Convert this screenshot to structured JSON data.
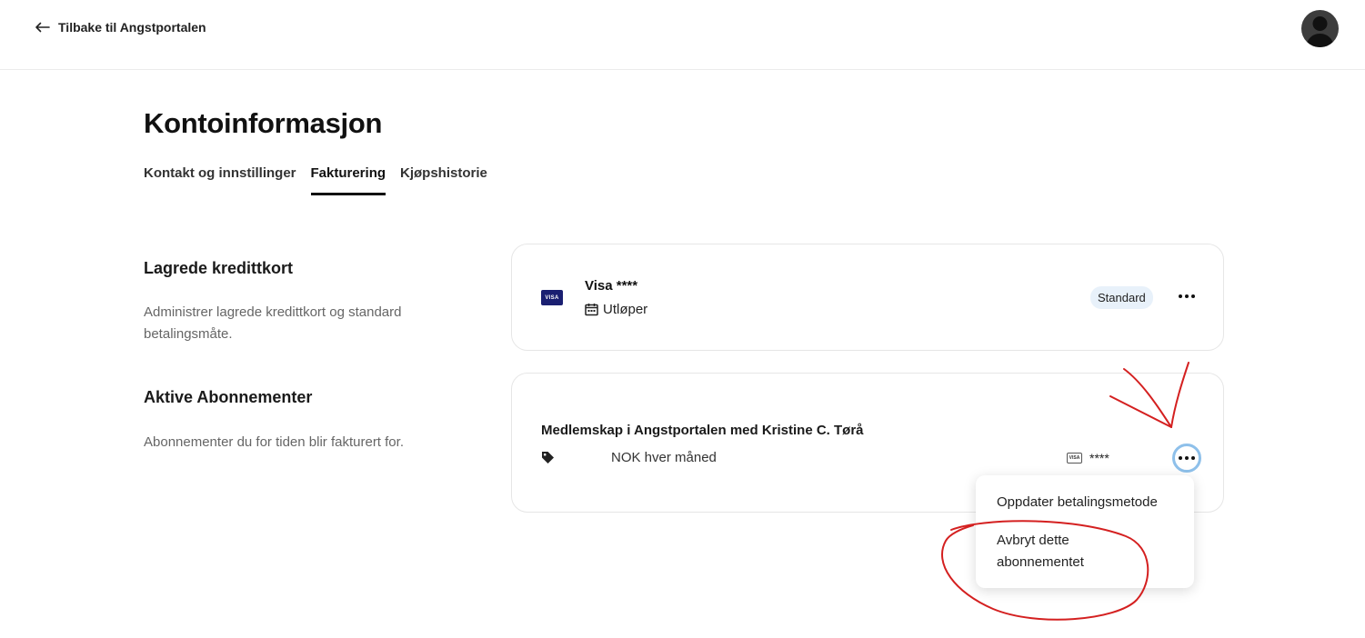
{
  "header": {
    "back_label": "Tilbake til Angstportalen"
  },
  "page": {
    "title": "Kontoinformasjon"
  },
  "tabs": [
    {
      "label": "Kontakt og innstillinger",
      "active": false
    },
    {
      "label": "Fakturering",
      "active": true
    },
    {
      "label": "Kjøpshistorie",
      "active": false
    }
  ],
  "credit_cards": {
    "title": "Lagrede kredittkort",
    "description": "Administrer lagrede kredittkort og standard betalingsmåte.",
    "card": {
      "brand_logo": "VISA",
      "name": "Visa ****",
      "expiry_label": "Utløper",
      "badge": "Standard"
    }
  },
  "subscriptions": {
    "title": "Aktive Abonnementer",
    "description": "Abonnementer du for tiden blir fakturert for.",
    "item": {
      "name": "Medlemskap i Angstportalen med Kristine C. Tørå",
      "price_text": "NOK hver måned",
      "card_logo": "VISA",
      "card_mask": "****"
    }
  },
  "menu": {
    "items": [
      "Oppdater betalingsmetode",
      "Avbryt dette abonnementet"
    ]
  },
  "colors": {
    "accent_ring": "#8ec0ea",
    "badge_bg": "#e8f1fa",
    "annotation": "#d42020"
  },
  "icons": [
    "arrow-left-icon",
    "avatar",
    "visa-logo",
    "calendar-icon",
    "tag-icon",
    "more-icon",
    "card-icon"
  ]
}
